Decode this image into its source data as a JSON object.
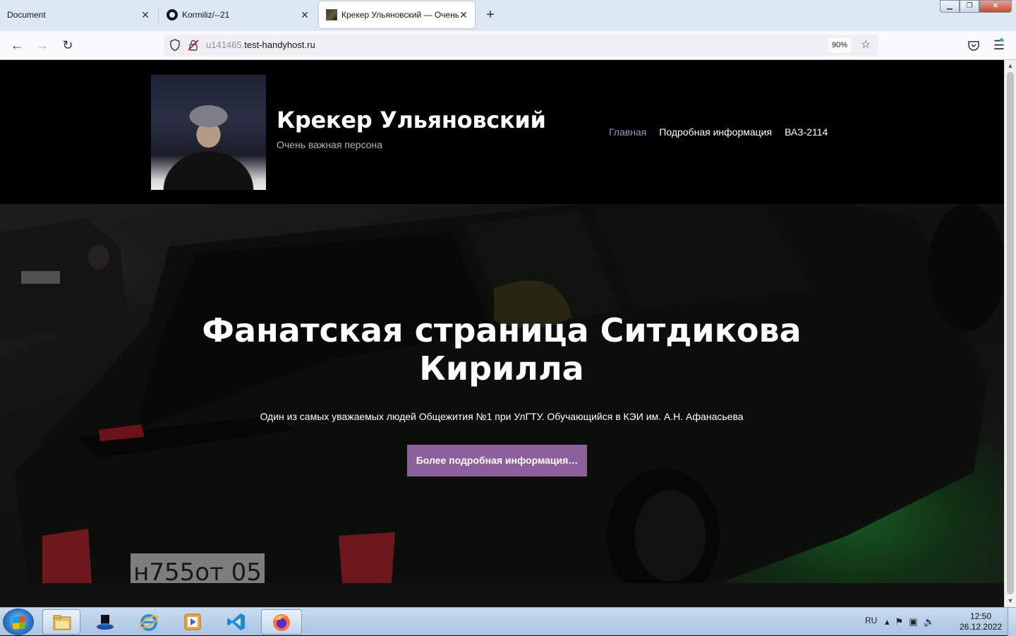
{
  "browser": {
    "tabs": [
      {
        "title": "Document",
        "active": false
      },
      {
        "title": "Kormiliz/--21",
        "active": false
      },
      {
        "title": "Крекер Ульяновский — Очень важная персона",
        "active": true
      }
    ],
    "url_host_prefix": "u141465.",
    "url_host_main": "test-handyhost.ru",
    "zoom": "90%"
  },
  "site": {
    "title": "Крекер Ульяновский",
    "tagline": "Очень важная персона",
    "nav": [
      {
        "label": "Главная",
        "current": true
      },
      {
        "label": "Подробная информация",
        "current": false
      },
      {
        "label": "ВАЗ-2114",
        "current": false
      }
    ],
    "accent_color": "#8c5f9d"
  },
  "hero": {
    "title": "Фанатская страница Ситдикова Кирилла",
    "text": "Один из самых уважаемых людей Общежития №1 при УлГТУ. Обучающийся в КЭИ им. А.Н. Афанасьева",
    "button": "Более подробная информация…",
    "plate": "н755от 05"
  },
  "taskbar": {
    "language": "RU",
    "time": "12:50",
    "date": "26.12.2022"
  }
}
